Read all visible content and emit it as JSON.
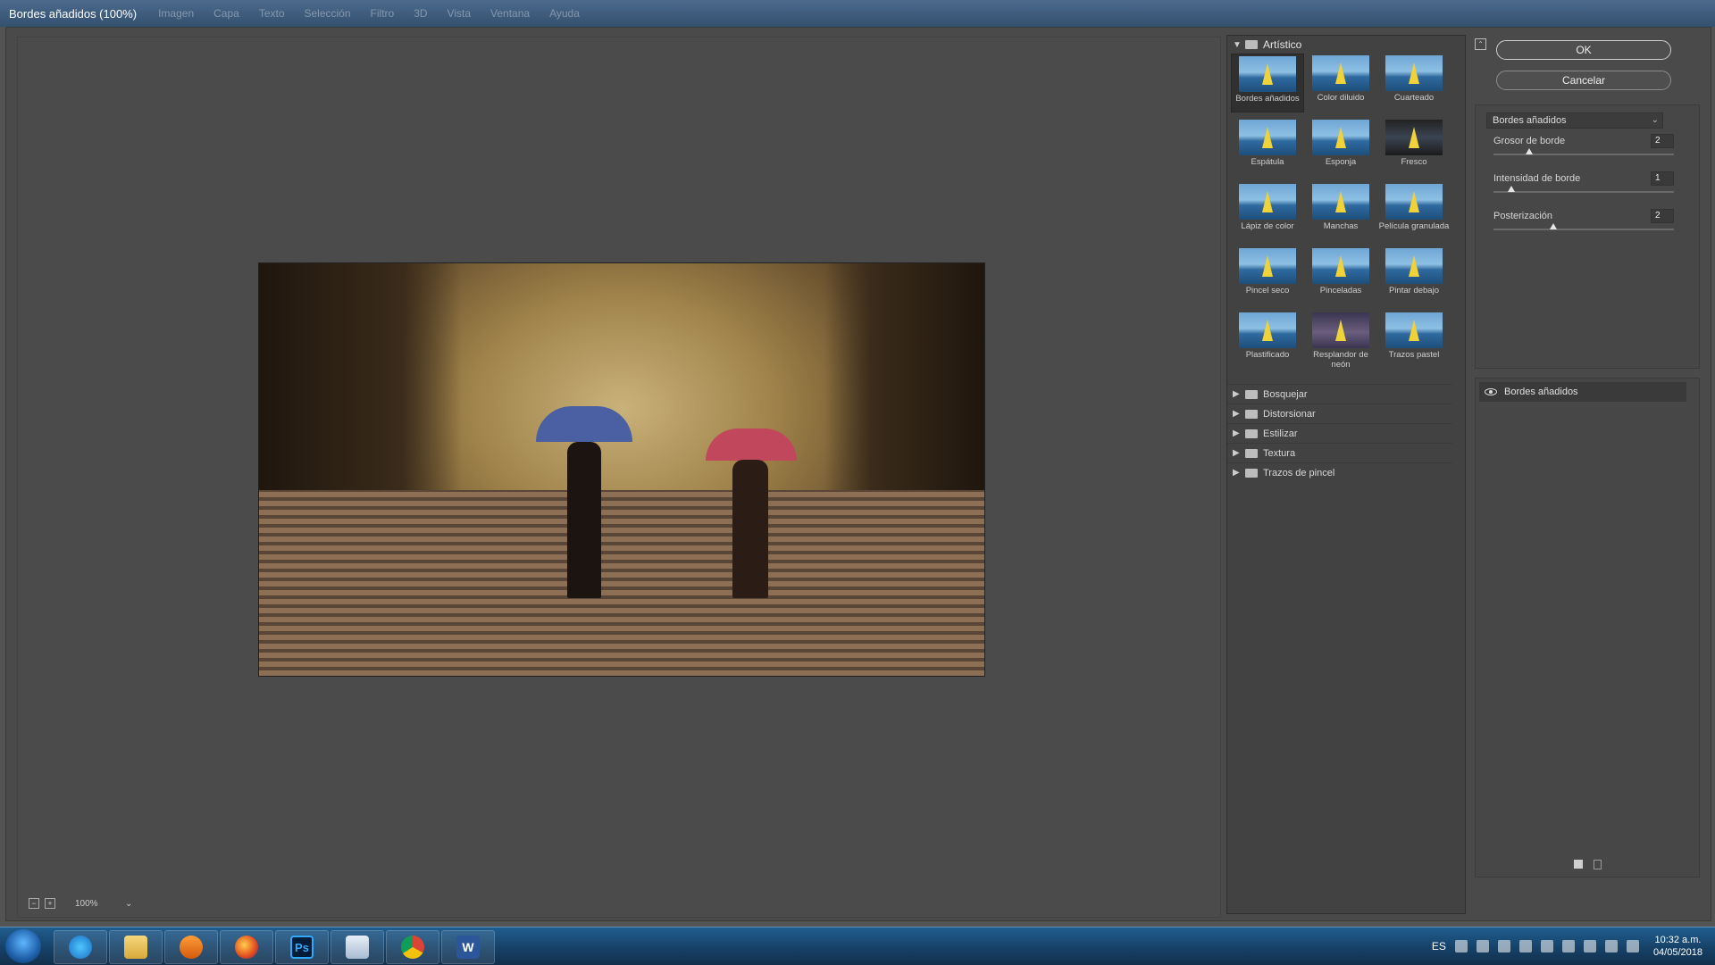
{
  "window": {
    "title": "Bordes añadidos (100%)",
    "menu": [
      "Imagen",
      "Capa",
      "Texto",
      "Selección",
      "Filtro",
      "3D",
      "Vista",
      "Ventana",
      "Ayuda"
    ]
  },
  "preview": {
    "zoom": "100%"
  },
  "gallery": {
    "artistic": {
      "label": "Artístico",
      "filters": [
        {
          "label": "Bordes añadidos",
          "selected": true
        },
        {
          "label": "Color diluido"
        },
        {
          "label": "Cuarteado"
        },
        {
          "label": "Espátula"
        },
        {
          "label": "Esponja"
        },
        {
          "label": "Fresco"
        },
        {
          "label": "Lápiz de color"
        },
        {
          "label": "Manchas"
        },
        {
          "label": "Película granulada"
        },
        {
          "label": "Pincel seco"
        },
        {
          "label": "Pinceladas"
        },
        {
          "label": "Pintar debajo"
        },
        {
          "label": "Plastificado"
        },
        {
          "label": "Resplandor de neón"
        },
        {
          "label": "Trazos pastel"
        }
      ]
    },
    "categories": [
      "Bosquejar",
      "Distorsionar",
      "Estilizar",
      "Textura",
      "Trazos de pincel"
    ]
  },
  "controls": {
    "ok": "OK",
    "cancel": "Cancelar",
    "filter_select": "Bordes añadidos",
    "params": [
      {
        "label": "Grosor de borde",
        "value": "2",
        "fraction": 0.2
      },
      {
        "label": "Intensidad de borde",
        "value": "1",
        "fraction": 0.1
      },
      {
        "label": "Posterización",
        "value": "2",
        "fraction": 0.33
      }
    ],
    "layer_name": "Bordes añadidos"
  },
  "taskbar": {
    "lang": "ES",
    "ps_label": "Ps",
    "word_label": "W",
    "time": "10:32 a.m.",
    "date": "04/05/2018"
  }
}
